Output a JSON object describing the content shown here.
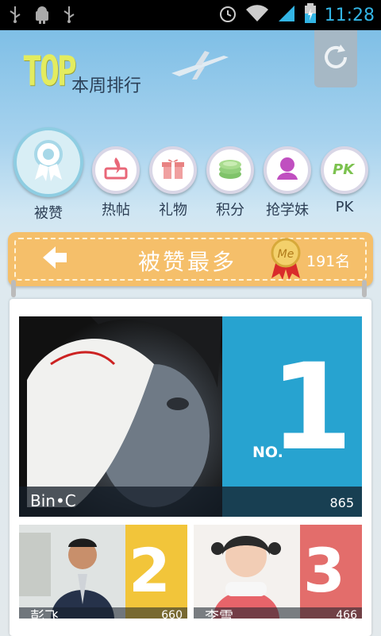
{
  "status": {
    "time": "11:28"
  },
  "header": {
    "logo": "TOP",
    "subtitle": "本周排行"
  },
  "categories": [
    {
      "label": "被赞",
      "icon": "medal-icon"
    },
    {
      "label": "热帖",
      "icon": "flame-post-icon"
    },
    {
      "label": "礼物",
      "icon": "gift-icon"
    },
    {
      "label": "积分",
      "icon": "coins-icon"
    },
    {
      "label": "抢学妹",
      "icon": "girl-icon"
    },
    {
      "label": "PK",
      "icon": "pk-icon"
    }
  ],
  "banner": {
    "title": "被赞最多",
    "medal": "Me",
    "rank": "191名"
  },
  "top1": {
    "rank_label": "NO.",
    "rank": "1",
    "name": "Bin•C",
    "score": "865"
  },
  "top2": {
    "rank": "2",
    "name": "彭飞",
    "score": "660"
  },
  "top3": {
    "rank": "3",
    "name": "李雪",
    "score": "466"
  },
  "colors": {
    "rank1": "#27a3d0",
    "rank2": "#f2c53a",
    "rank3": "#e36d6b",
    "banner": "#f5bf6a"
  }
}
